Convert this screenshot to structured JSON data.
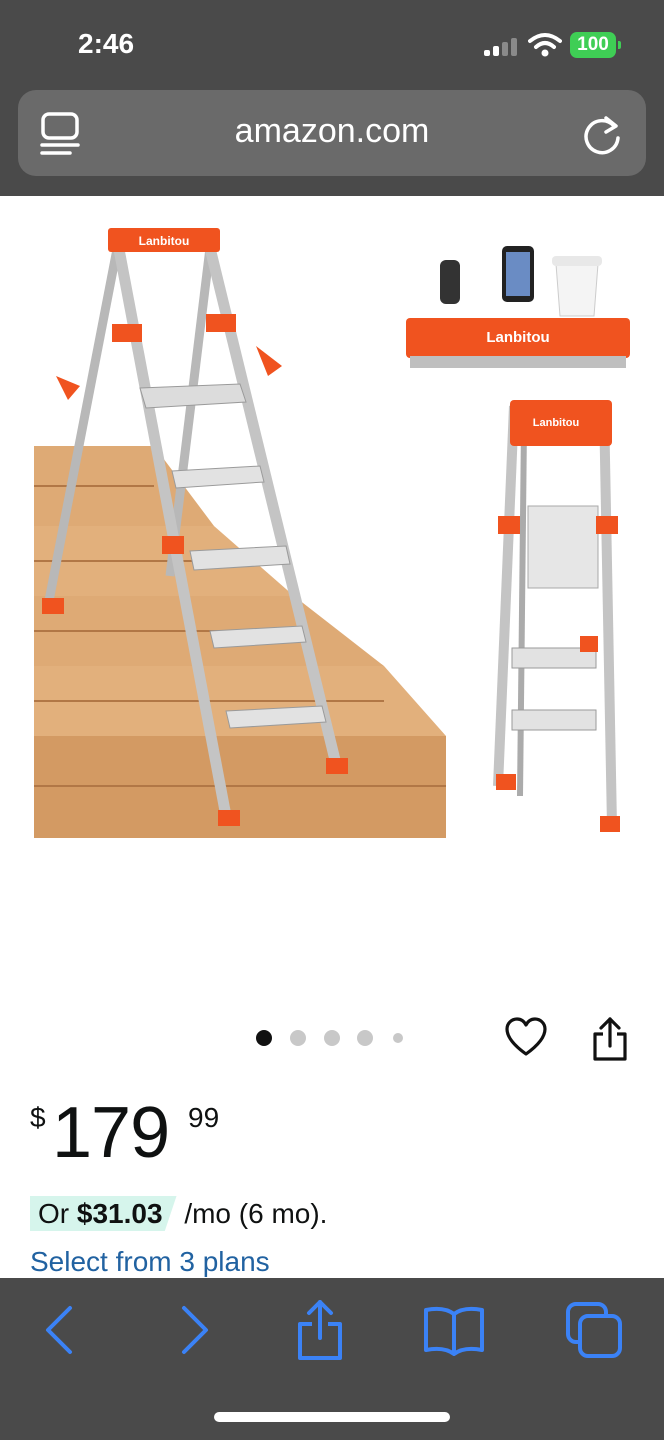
{
  "status_bar": {
    "time": "2:46",
    "battery": "100"
  },
  "browser": {
    "url": "amazon.com"
  },
  "product": {
    "image_brand_text": "Lanbitou",
    "image_count": 5,
    "selected_image": 1,
    "price": {
      "symbol": "$",
      "whole": "179",
      "fraction": "99"
    },
    "installment": {
      "prefix": "Or",
      "amount": "$31.03",
      "suffix": "/mo (6 mo)."
    },
    "plans_link": "Select from 3 plans"
  },
  "colors": {
    "accent_orange": "#f0531f",
    "link_blue": "#2162a1",
    "chrome": "#4a4a4a",
    "toolbar_icon": "#3b82f6"
  },
  "toolbar": {
    "icons": [
      "back-icon",
      "forward-icon",
      "share-icon",
      "bookmarks-icon",
      "tabs-icon"
    ]
  }
}
